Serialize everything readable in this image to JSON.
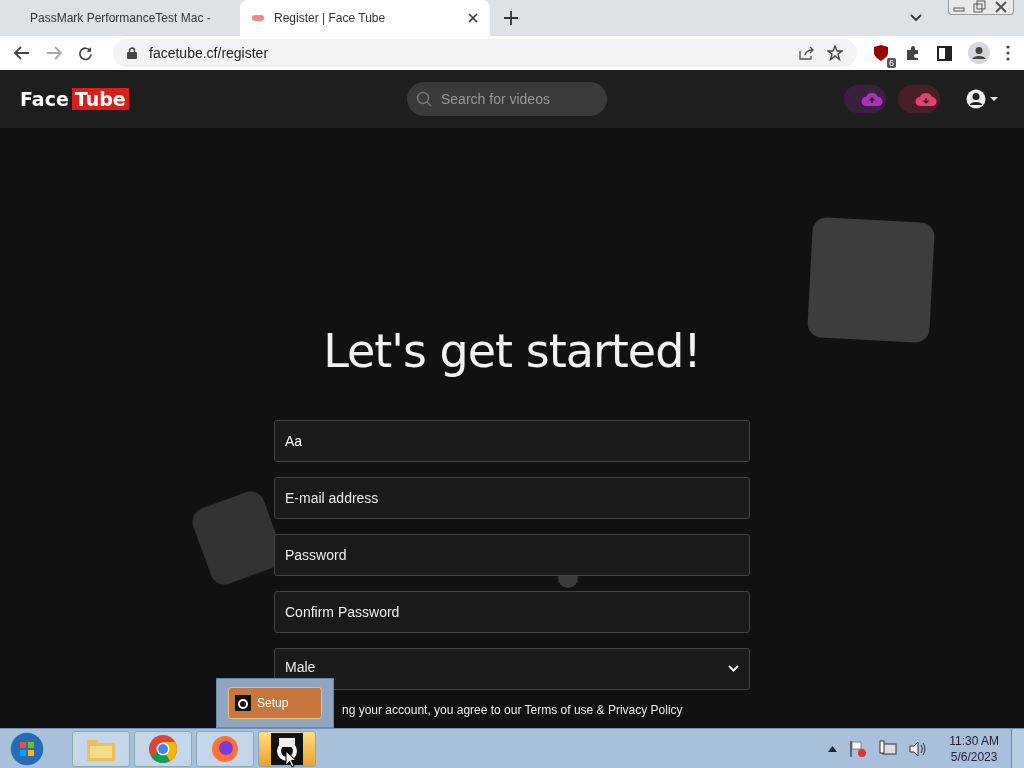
{
  "browser": {
    "tabs": [
      {
        "title": "PassMark PerformanceTest Mac -",
        "selected": false
      },
      {
        "title": "Register | Face Tube",
        "selected": true
      }
    ],
    "url": "facetube.cf/register",
    "extension_badge": "6"
  },
  "site": {
    "logo": {
      "part1": "Face",
      "part2": "Tube"
    },
    "search": {
      "placeholder": "Search for videos"
    }
  },
  "form": {
    "heading": "Let's get started!",
    "fields": [
      {
        "kind": "input",
        "value": "Aa"
      },
      {
        "kind": "input",
        "placeholder": "E-mail address"
      },
      {
        "kind": "input",
        "placeholder": "Password"
      },
      {
        "kind": "input",
        "placeholder": "Confirm Password"
      },
      {
        "kind": "select",
        "value": "Male"
      }
    ],
    "terms": "ng your account, you agree to our Terms of use & Privacy Policy"
  },
  "taskbar": {
    "items": [
      {
        "kind": "explorer",
        "selected": false
      },
      {
        "kind": "chrome",
        "selected": false
      },
      {
        "kind": "firefox",
        "selected": false
      },
      {
        "kind": "setup",
        "selected": true
      }
    ],
    "preview": {
      "title": "Setup"
    },
    "time": "11:30 AM",
    "date": "5/6/2023"
  }
}
